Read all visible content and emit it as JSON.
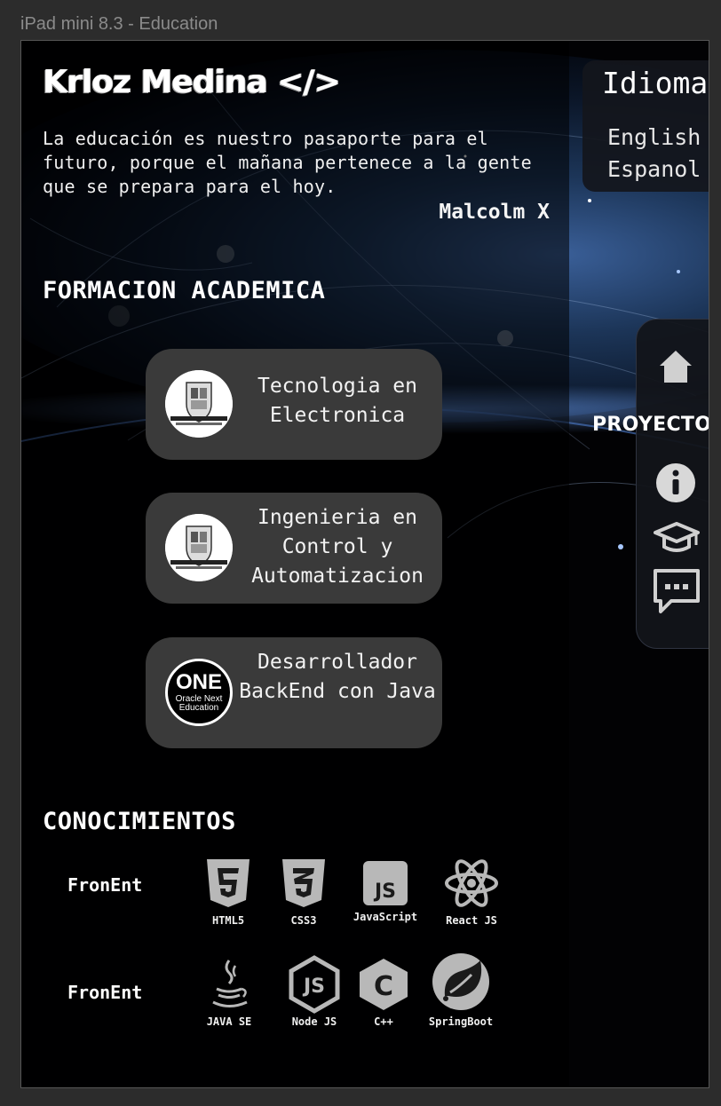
{
  "frame_label": "iPad mini 8.3 - Education",
  "header": {
    "logo": "Krloz Medina </>",
    "quote": "La educación es nuestro pasaporte para el futuro, porque el mañana pertenece a la gente que se prepara para el hoy.",
    "quote_author": "Malcolm X"
  },
  "education": {
    "title": "FORMACION ACADEMICA",
    "cards": [
      {
        "title": "Tecnologia en Electronica",
        "logo": "universidad-distrital-logo"
      },
      {
        "title": "Ingenieria en Control y Automatizacion",
        "logo": "universidad-distrital-logo"
      },
      {
        "title": "Desarrollador BackEnd con Java",
        "logo": "oracle-next-education-logo",
        "logo_text": {
          "main": "ONE",
          "sub1": "Oracle Next",
          "sub2": "Education"
        }
      }
    ]
  },
  "knowledge": {
    "title": "CONOCIMIENTOS",
    "rows": [
      {
        "label": "FronEnt",
        "skills": [
          {
            "name": "HTML5",
            "icon": "html5-icon"
          },
          {
            "name": "CSS3",
            "icon": "css3-icon"
          },
          {
            "name": "JavaScript",
            "icon": "javascript-icon"
          },
          {
            "name": "React JS",
            "icon": "react-icon"
          }
        ]
      },
      {
        "label": "FronEnt",
        "skills": [
          {
            "name": "JAVA SE",
            "icon": "java-icon"
          },
          {
            "name": "Node JS",
            "icon": "nodejs-icon"
          },
          {
            "name": "C++",
            "icon": "cpp-icon"
          },
          {
            "name": "SpringBoot",
            "icon": "spring-icon"
          }
        ]
      }
    ]
  },
  "language_menu": {
    "title": "Idioma",
    "options": [
      "English",
      "Espanol"
    ]
  },
  "side_nav": {
    "items": [
      {
        "name": "home",
        "icon": "home-icon"
      },
      {
        "name": "projects",
        "label": "PROYECTOS"
      },
      {
        "name": "about",
        "icon": "info-icon"
      },
      {
        "name": "education",
        "icon": "graduation-cap-icon"
      },
      {
        "name": "contact",
        "icon": "chat-icon"
      }
    ]
  },
  "colors": {
    "background": "#020204",
    "card": "#3a3a3a",
    "icon_gray": "#b8b8b8",
    "panel": "#14161c"
  }
}
